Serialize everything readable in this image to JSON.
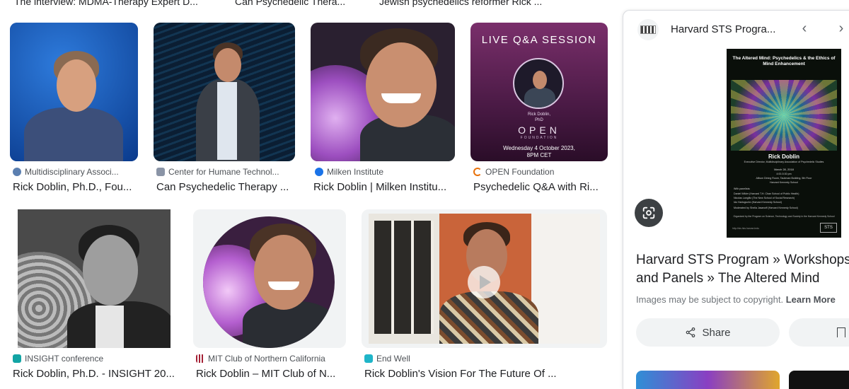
{
  "top_captions": [
    "The interview: MDMA-Therapy Expert D...",
    "Can Psychedelic Thera...",
    "Jewish psychedelics reformer Rick ..."
  ],
  "results": [
    {
      "source": "Multidisciplinary Associ...",
      "title": "Rick Doblin, Ph.D., Fou...",
      "favicon_color": "#5b7fb0"
    },
    {
      "source": "Center for Humane Technol...",
      "title": "Can Psychedelic Therapy ...",
      "favicon_color": "#8a94a6"
    },
    {
      "source": "Milken Institute",
      "title": "Rick Doblin | Milken Institu...",
      "favicon_color": "#1a73e8"
    },
    {
      "source": "OPEN Foundation",
      "title": "Psychedelic Q&A with Ri...",
      "favicon_color": "#e8710a"
    },
    {
      "source": "INSIGHT conference",
      "title": "Rick Doblin, Ph.D. - INSIGHT 20...",
      "favicon_color": "#12a4a4"
    },
    {
      "source": "MIT Club of Northern California",
      "title": "Rick Doblin – MIT Club of N...",
      "favicon_color": "#a31f34"
    },
    {
      "source": "End Well",
      "title": "Rick Doblin's Vision For The Future Of ...",
      "favicon_color": "#1fb5c8"
    }
  ],
  "open_foundation_card": {
    "heading": "LIVE Q&A SESSION",
    "name": "Rick Doblin,",
    "degree": "PhD",
    "brand": "OPEN",
    "brand_sub": "FOUNDATION",
    "date": "Wednesday 4 October 2023,",
    "time": "8PM CET"
  },
  "panel": {
    "site_name": "Harvard STS Progra...",
    "title": "Harvard STS Program » Workshops and Panels » The Altered Mind",
    "copyright_text": "Images may be subject to copyright.",
    "learn_more": "Learn More",
    "share_label": "Share",
    "poster": {
      "title": "The Altered Mind: Psychedelics & the Ethics of Mind Enhancement",
      "speaker": "Rick Doblin",
      "speaker_role": "Executive Director, Multidisciplinary Association of Psychedelic Studies",
      "date": "March 28, 2018",
      "time": "4:00-5:30 pm",
      "venue": "Allison Dining Room, Taubman Building, 5th Floor",
      "school": "Harvard Kennedy School",
      "panelists_label": "With panelists:",
      "panelist_1": "Daniel Wikler (Harvard T.H. Chan School of Public Health)",
      "panelist_2": "Nicolas Langlitz (The New School of Social Research)",
      "panelist_3": "Ido Hartogsohn (Harvard Kennedy School)",
      "moderator": "Moderated by Sheila Jasanoff (Harvard Kennedy School)",
      "organizer": "Organized by the Program on Science, Technology and Society in the Harvard Kennedy School",
      "url": "http://sts.hks.harvard.edu",
      "logo": "STS"
    }
  }
}
